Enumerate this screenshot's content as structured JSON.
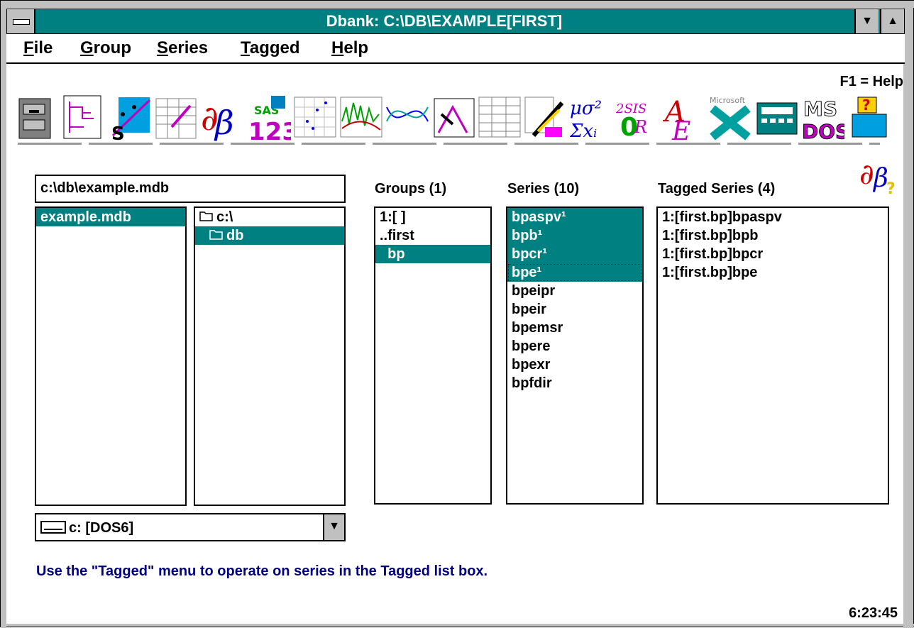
{
  "window": {
    "title": "Dbank: C:\\DB\\EXAMPLE[FIRST]"
  },
  "menu": [
    "File",
    "Group",
    "Series",
    "Tagged",
    "Help"
  ],
  "menu_underline": [
    "F",
    "G",
    "S",
    "T",
    "H"
  ],
  "help_hint": "F1 = Help",
  "toolbar_icons": [
    "file-cabinet-icon",
    "tree-icon",
    "scatter-fit-icon",
    "spreadsheet-edit-icon",
    "db-logo-icon",
    "sas-123-icon",
    "scatter-grid-icon",
    "line-graph-icon",
    "curves-icon",
    "hand-chart-icon",
    "table-icon",
    "pencil-edit-icon",
    "stats-formula-icon",
    "stats-packages-icon",
    "ae-icon",
    "excel-icon",
    "calculator-icon",
    "msdos-icon",
    "help-toolbox-icon"
  ],
  "path_box": "c:\\db\\example.mdb",
  "file_list": [
    {
      "label": "example.mdb",
      "selected": true
    }
  ],
  "dir_list": [
    {
      "label": "c:\\",
      "selected": false,
      "open": false
    },
    {
      "label": "db",
      "selected": true,
      "open": true
    }
  ],
  "drive": "c: [DOS6]",
  "groups": {
    "label": "Groups (1)",
    "items": [
      {
        "label": "1:[ ]",
        "selected": false
      },
      {
        "label": "..first",
        "selected": false
      },
      {
        "label": "  bp",
        "selected": true
      }
    ]
  },
  "series": {
    "label": "Series (10)",
    "items": [
      {
        "label": "bpaspv¹",
        "selected": true
      },
      {
        "label": "bpb¹",
        "selected": true
      },
      {
        "label": "bpcr¹",
        "selected": true
      },
      {
        "label": "bpe¹",
        "selected": true,
        "focus": true
      },
      {
        "label": "bpeipr",
        "selected": false
      },
      {
        "label": "bpeir",
        "selected": false
      },
      {
        "label": "bpemsr",
        "selected": false
      },
      {
        "label": "bpere",
        "selected": false
      },
      {
        "label": "bpexr",
        "selected": false
      },
      {
        "label": "bpfdir",
        "selected": false
      }
    ]
  },
  "tagged": {
    "label": "Tagged Series (4)",
    "items": [
      {
        "label": "1:[first.bp]bpaspv"
      },
      {
        "label": "1:[first.bp]bpb"
      },
      {
        "label": "1:[first.bp]bpcr"
      },
      {
        "label": "1:[first.bp]bpe"
      }
    ]
  },
  "status_message": "Use the \"Tagged\" menu to operate on series in the Tagged list box.",
  "clock": "6:23:45",
  "colors": {
    "accent": "#008080",
    "status": "#000080",
    "frame": "#c0c0c0"
  }
}
